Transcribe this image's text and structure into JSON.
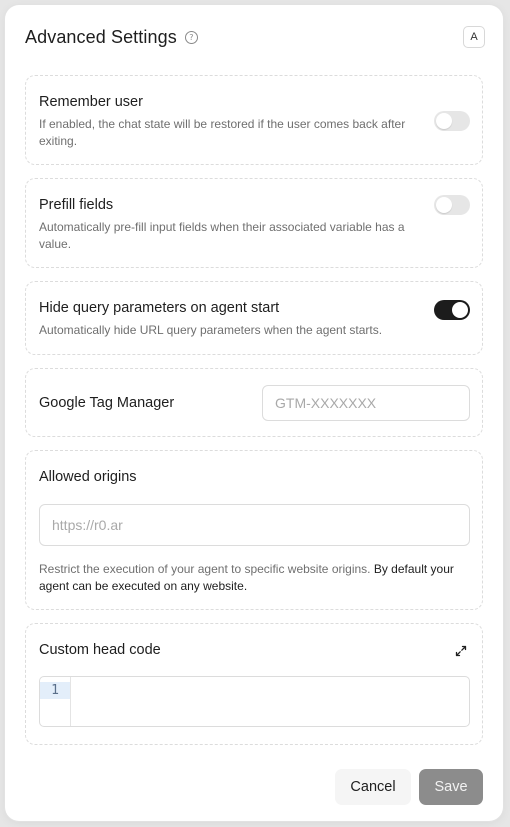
{
  "dialog": {
    "title": "Advanced Settings",
    "help_icon": "question-circle-icon",
    "avatar_letter": "A"
  },
  "settings": {
    "remember_user": {
      "title": "Remember user",
      "description": "If enabled, the chat state will be restored if the user comes back after exiting.",
      "enabled": false
    },
    "prefill_fields": {
      "title": "Prefill fields",
      "description": "Automatically pre-fill input fields when their associated variable has a value.",
      "enabled": false
    },
    "hide_query_params": {
      "title": "Hide query parameters on agent start",
      "description": "Automatically hide URL query parameters when the agent starts.",
      "enabled": true
    },
    "google_tag_manager": {
      "title": "Google Tag Manager",
      "value": "",
      "placeholder": "GTM-XXXXXXX"
    },
    "allowed_origins": {
      "title": "Allowed origins",
      "value": "",
      "placeholder": "https://r0.ar",
      "description_part1": "Restrict the execution of your agent to specific website origins.",
      "description_part2": "By default your agent can be executed on any website."
    },
    "custom_head_code": {
      "title": "Custom head code",
      "expand_icon": "expand-arrows-icon",
      "line_number": "1",
      "code": ""
    }
  },
  "footer": {
    "cancel_label": "Cancel",
    "save_label": "Save"
  },
  "colors": {
    "toggle_on": "#1c1c1c",
    "toggle_off": "#e6e6e6",
    "save_disabled": "#8c8c8c"
  }
}
